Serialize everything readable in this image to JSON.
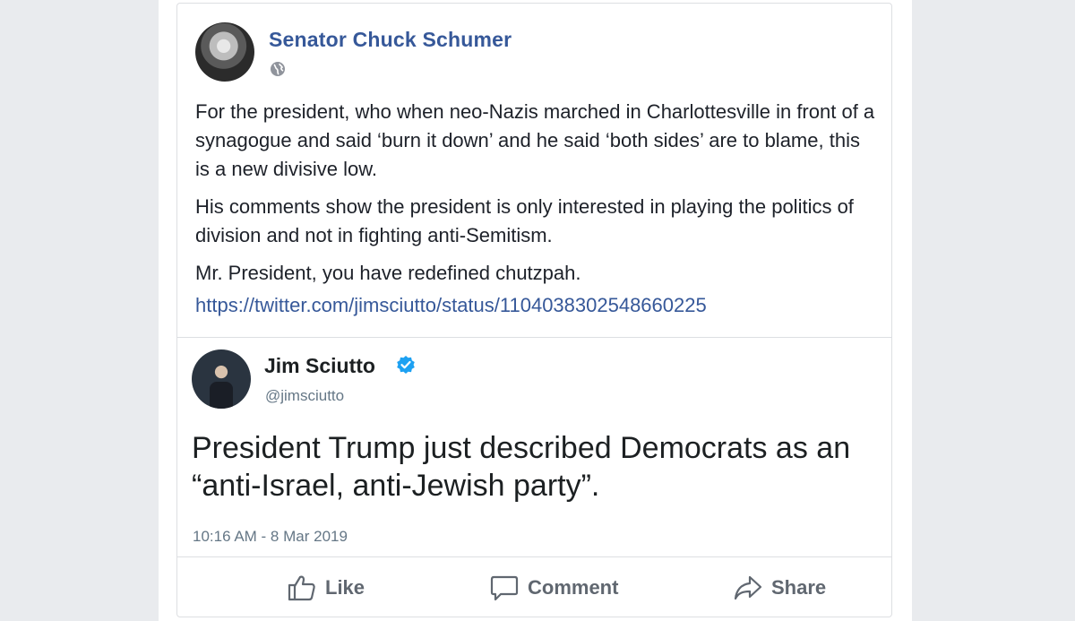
{
  "post": {
    "author": "Senator Chuck Schumer",
    "privacy_icon": "globe-icon",
    "paragraphs": [
      "For the president, who when neo-Nazis marched in Charlottesville in front of a synagogue and said ‘burn it down’ and he said ‘both sides’ are to blame, this is a new divisive low.",
      "His comments show the president is only interested in playing the politics of division and not in fighting anti-Semitism.",
      "Mr. President, you have redefined chutzpah."
    ],
    "link": "https://twitter.com/jimsciutto/status/1104038302548660225"
  },
  "tweet": {
    "name": "Jim Sciutto",
    "verified_icon": "verified-badge-icon",
    "handle": "@jimsciutto",
    "text": "President Trump just described Democrats as an “anti-Israel, anti-Jewish party”.",
    "timestamp": "10:16 AM - 8 Mar 2019"
  },
  "actions": {
    "like": "Like",
    "comment": "Comment",
    "share": "Share"
  },
  "colors": {
    "link_blue": "#365899",
    "verified_blue": "#1da1f2",
    "action_gray": "#606770"
  }
}
